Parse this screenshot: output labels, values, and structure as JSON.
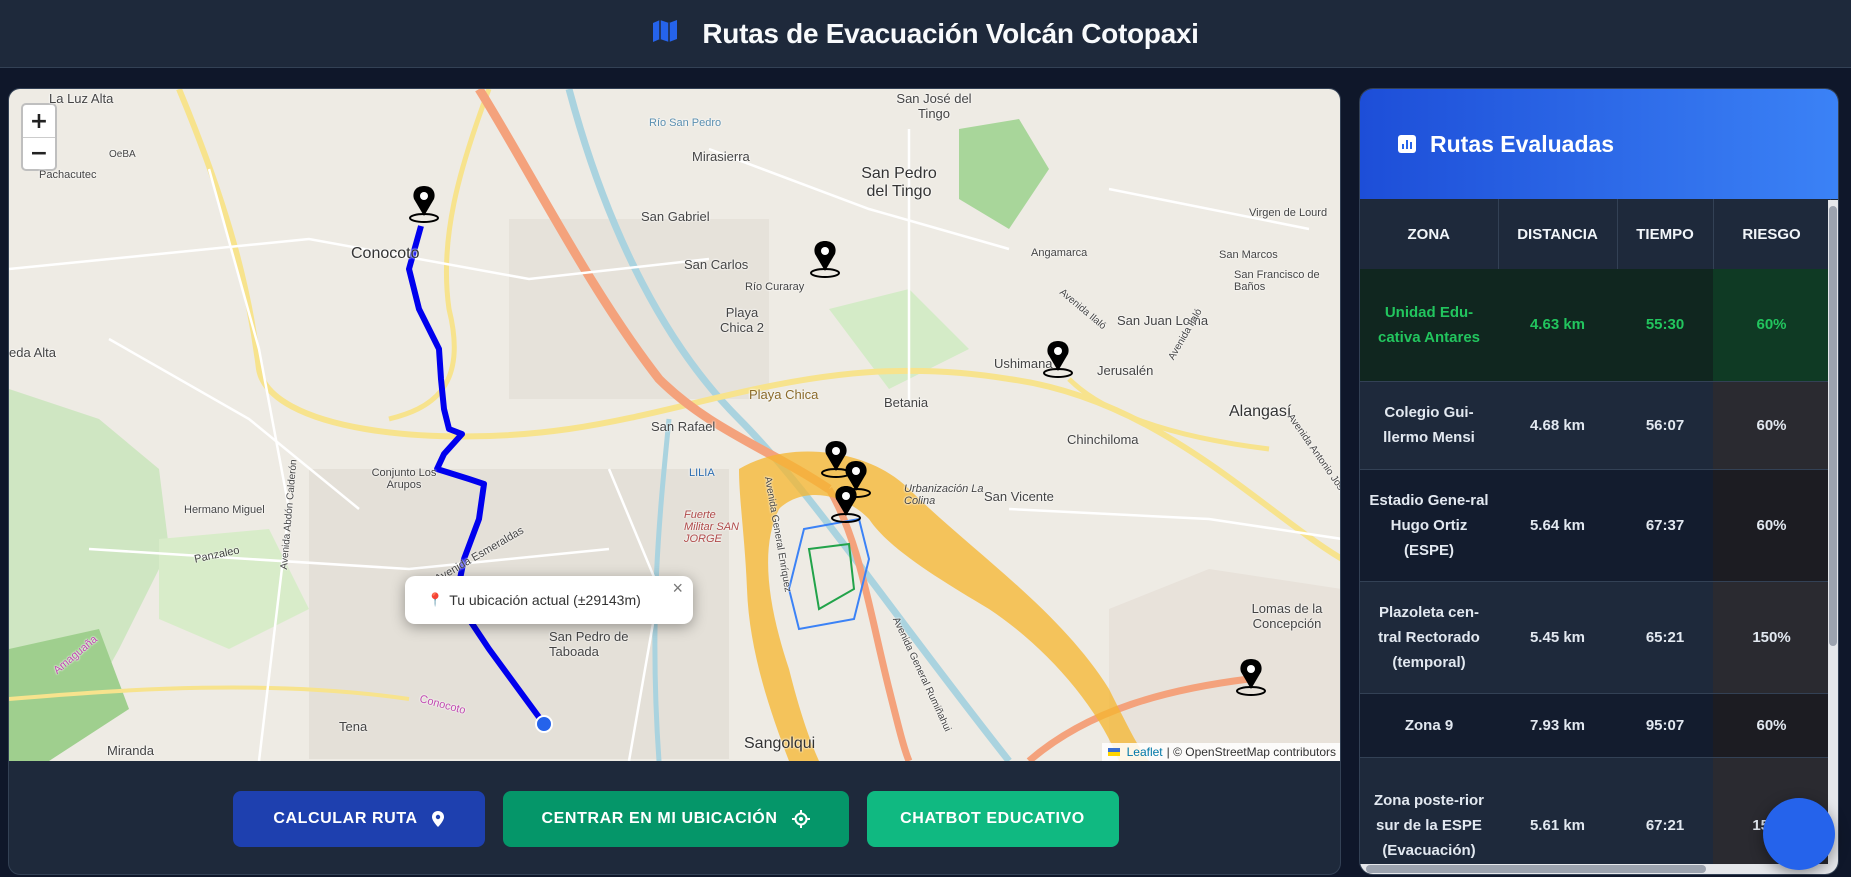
{
  "header": {
    "title": "Rutas de Evacuación Volcán Cotopaxi",
    "icon": "map-icon"
  },
  "map": {
    "zoom_in": "+",
    "zoom_out": "−",
    "labels": {
      "la_luz_alta": "La Luz Alta",
      "pachacutec": "Pachacutec",
      "oeba": "OeBA",
      "conocoto": "Conocoto",
      "eda_alta": "eda Alta",
      "san_jose_tingo": "San José del Tingo",
      "mirasierra": "Mirasierra",
      "rio_san_pedro": "Río San Pedro",
      "san_pedro_tingo": "San Pedro del Tingo",
      "san_gabriel": "San Gabriel",
      "san_carlos": "San Carlos",
      "rio_curaray": "Río Curaray",
      "playa_chica_2": "Playa Chica 2",
      "angamarca": "Angamarca",
      "san_marcos": "San Marcos",
      "virgen_lourdes": "Virgen de Lourd",
      "san_francisco": "San Francisco de Baños",
      "san_juan_loma": "San Juan Loma",
      "avenida_ilalo": "Avenida Ilaló",
      "ushimana": "Ushimana",
      "jerusalen": "Jerusalén",
      "alangasi": "Alangasí",
      "playa_chica": "Playa Chica",
      "betania": "Betania",
      "san_rafael": "San Rafael",
      "chinchiloma": "Chinchiloma",
      "lilia": "LILIA",
      "fuerte_militar": "Fuerte Militar SAN JORGE",
      "conjunto_arupos": "Conjunto Los Arupos",
      "hermano_miguel": "Hermano Miguel",
      "panzaleo": "Panzaleo",
      "avenida_esmeraldas": "Avenida Esmeraldas",
      "san_pedro_taboada": "San Pedro de Taboada",
      "urbanizacion": "Urbanización La Colina",
      "san_vicente": "San Vicente",
      "lomas_concepcion": "Lomas de la Concepción",
      "sangolqui": "Sangolqui",
      "tena": "Tena",
      "miranda": "Miranda",
      "amaguana": "Amaguaña",
      "conocoto_road": "Conocoto",
      "avenida_abdon": "Avenida Abdón Calderón",
      "avenida_general_enriquez": "Avenida General Enríquez",
      "avenida_general_rumi": "Avenida General Rumiñahui",
      "avenida_ilalo_2": "Avenida Ilaló",
      "avenida_antonio": "Avenida Antonio José"
    },
    "popup": {
      "icon": "📍",
      "text": "Tu ubicación actual (±29143m)",
      "close": "×"
    },
    "attribution": {
      "leaflet": "Leaflet",
      "rest": "| © OpenStreetMap contributors"
    }
  },
  "buttons": {
    "calcular": "CALCULAR RUTA",
    "centrar": "CENTRAR EN MI UBICACIÓN",
    "chatbot": "CHATBOT EDUCATIVO"
  },
  "panel": {
    "title": "Rutas Evaluadas",
    "columns": [
      "ZONA",
      "DISTANCIA",
      "TIEMPO",
      "RIESGO"
    ],
    "rows": [
      {
        "zona": "Unidad Edu-cativa Antares",
        "distancia": "4.63 km",
        "tiempo": "55:30",
        "riesgo": "60%"
      },
      {
        "zona": "Colegio Gui-llermo Mensi",
        "distancia": "4.68 km",
        "tiempo": "56:07",
        "riesgo": "60%"
      },
      {
        "zona": "Estadio Gene-ral Hugo Ortiz (ESPE)",
        "distancia": "5.64 km",
        "tiempo": "67:37",
        "riesgo": "60%"
      },
      {
        "zona": "Plazoleta cen-tral Rectorado (temporal)",
        "distancia": "5.45 km",
        "tiempo": "65:21",
        "riesgo": "150%"
      },
      {
        "zona": "Zona 9",
        "distancia": "7.93 km",
        "tiempo": "95:07",
        "riesgo": "60%"
      },
      {
        "zona": "Zona poste-rior sur de la ESPE (Evacuación)",
        "distancia": "5.61 km",
        "tiempo": "67:21",
        "riesgo": "150%"
      }
    ]
  },
  "colors": {
    "route": "#0000ff",
    "hazard": "#f5b52e",
    "accent": "#3b82f6",
    "best": "#22c55e"
  }
}
